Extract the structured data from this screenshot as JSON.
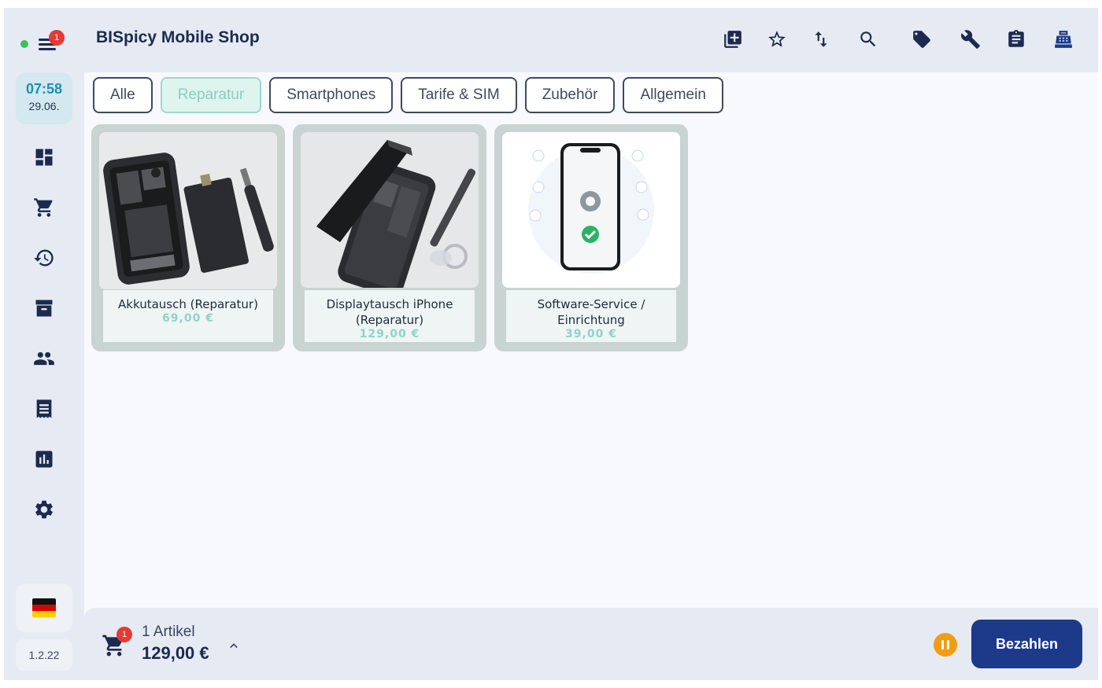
{
  "app": {
    "title": "BISpicy Mobile Shop"
  },
  "sidebar": {
    "menu_badge": "1",
    "clock": {
      "time": "07:58",
      "date": "29.06."
    },
    "items": [
      {
        "icon": "dashboard-icon"
      },
      {
        "icon": "cart-icon"
      },
      {
        "icon": "history-icon"
      },
      {
        "icon": "archive-icon"
      },
      {
        "icon": "people-icon"
      },
      {
        "icon": "receipt-icon"
      },
      {
        "icon": "chart-icon"
      },
      {
        "icon": "settings-gear-icon"
      }
    ],
    "language_flag": "germany-flag-icon",
    "version": "1.2.22"
  },
  "toolbar": {
    "icons": [
      "add-box-icon",
      "star-icon",
      "sort-arrows-icon",
      "search-icon",
      "tag-icon",
      "wrench-icon",
      "clipboard-icon",
      "cash-register-icon"
    ]
  },
  "tabs": [
    {
      "label": "Alle",
      "active": false
    },
    {
      "label": "Reparatur",
      "active": true
    },
    {
      "label": "Smartphones",
      "active": false
    },
    {
      "label": "Tarife & SIM",
      "active": false
    },
    {
      "label": "Zubehör",
      "active": false
    },
    {
      "label": "Allgemein",
      "active": false
    }
  ],
  "products": [
    {
      "name": "Akkutausch (Reparatur)",
      "price": "69,00 €",
      "image": "disassembled-phone-battery"
    },
    {
      "name": "Displaytausch iPhone (Reparatur)",
      "price": "129,00 €",
      "image": "phone-screen-replacement"
    },
    {
      "name": "Software-Service / Einrichtung",
      "price": "39,00 €",
      "image": "phone-settings-check"
    }
  ],
  "footer": {
    "cart_badge": "1",
    "items_label": "1 Artikel",
    "total": "129,00 €",
    "pay_label": "Bezahlen"
  },
  "colors": {
    "accent": "#1d3a8a",
    "active_tab": "#86d0c2",
    "price": "#8fd3c6",
    "badge": "#e53935",
    "pause": "#f39c12"
  }
}
